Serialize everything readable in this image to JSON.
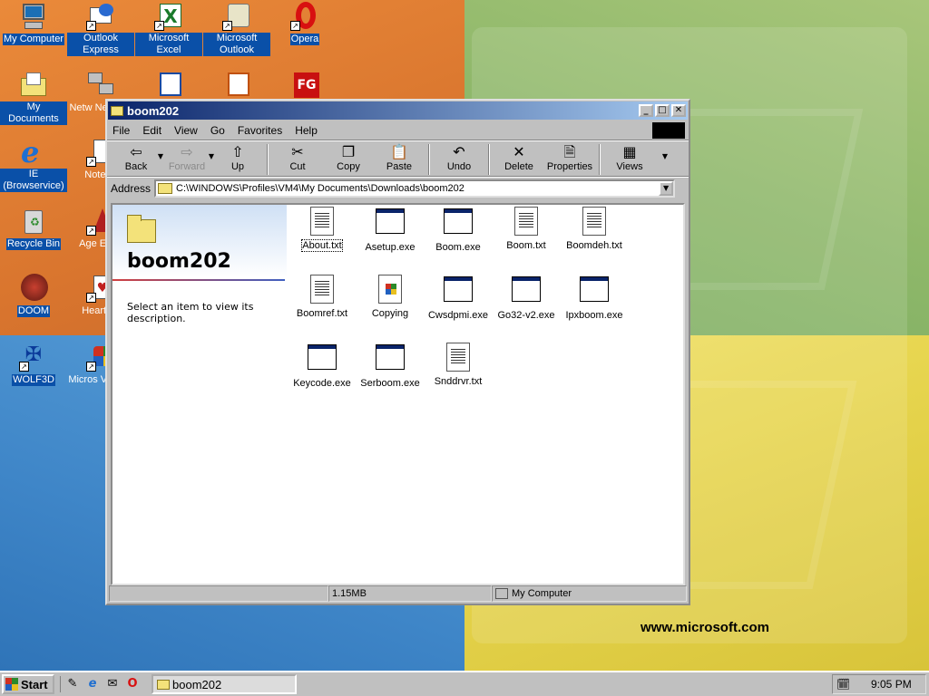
{
  "desktop": {
    "website": "www.microsoft.com",
    "icons": [
      {
        "label": "My Computer",
        "icon": "computer-icon"
      },
      {
        "label": "Outlook Express",
        "icon": "outlook-express-icon"
      },
      {
        "label": "Microsoft Excel",
        "icon": "excel-icon"
      },
      {
        "label": "Microsoft Outlook",
        "icon": "outlook-icon"
      },
      {
        "label": "Opera",
        "icon": "opera-icon"
      },
      {
        "label": "My Documents",
        "icon": "my-documents-icon"
      },
      {
        "label": "Netw Neighbo",
        "icon": "network-icon"
      },
      {
        "label": "IE (Browservice)",
        "icon": "ie-icon"
      },
      {
        "label": "Notepa",
        "icon": "notepad-icon"
      },
      {
        "label": "Recycle Bin",
        "icon": "recycle-bin-icon"
      },
      {
        "label": "Age Empi",
        "icon": "age-of-empires-icon"
      },
      {
        "label": "DOOM",
        "icon": "doom-icon"
      },
      {
        "label": "Hearts d",
        "icon": "hearts-icon"
      },
      {
        "label": "WOLF3D",
        "icon": "wolf3d-icon"
      },
      {
        "label": "Micros Visual I",
        "icon": "visual-studio-icon"
      }
    ]
  },
  "window": {
    "title": "boom202",
    "menu": [
      "File",
      "Edit",
      "View",
      "Go",
      "Favorites",
      "Help"
    ],
    "toolbar": {
      "back": "Back",
      "forward": "Forward",
      "up": "Up",
      "cut": "Cut",
      "copy": "Copy",
      "paste": "Paste",
      "undo": "Undo",
      "delete": "Delete",
      "properties": "Properties",
      "views": "Views"
    },
    "address_label": "Address",
    "address": "C:\\WINDOWS\\Profiles\\VM4\\My Documents\\Downloads\\boom202",
    "folder_title": "boom202",
    "folder_desc": "Select an item to view its description.",
    "files": [
      {
        "name": "About.txt",
        "type": "txt"
      },
      {
        "name": "Asetup.exe",
        "type": "exe"
      },
      {
        "name": "Boom.exe",
        "type": "exe"
      },
      {
        "name": "Boom.txt",
        "type": "txt"
      },
      {
        "name": "Boomdeh.txt",
        "type": "txt"
      },
      {
        "name": "Boomref.txt",
        "type": "txt"
      },
      {
        "name": "Copying",
        "type": "win"
      },
      {
        "name": "Cwsdpmi.exe",
        "type": "exe"
      },
      {
        "name": "Go32-v2.exe",
        "type": "exe"
      },
      {
        "name": "Ipxboom.exe",
        "type": "exe"
      },
      {
        "name": "Keycode.exe",
        "type": "exe"
      },
      {
        "name": "Serboom.exe",
        "type": "exe"
      },
      {
        "name": "Snddrvr.txt",
        "type": "txt"
      }
    ],
    "status": {
      "size": "1.15MB",
      "zone": "My Computer"
    }
  },
  "taskbar": {
    "start": "Start",
    "task": "boom202",
    "clock": "9:05 PM"
  }
}
